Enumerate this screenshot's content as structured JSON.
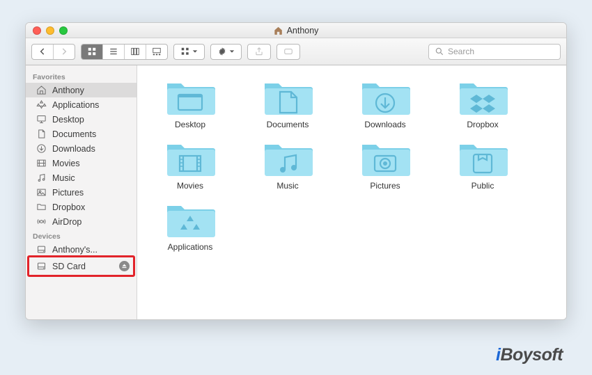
{
  "window": {
    "title": "Anthony"
  },
  "sidebar": {
    "favorites_header": "Favorites",
    "devices_header": "Devices",
    "items": [
      {
        "label": "Anthony",
        "icon": "home"
      },
      {
        "label": "Applications",
        "icon": "apps"
      },
      {
        "label": "Desktop",
        "icon": "desktop"
      },
      {
        "label": "Documents",
        "icon": "doc"
      },
      {
        "label": "Downloads",
        "icon": "down"
      },
      {
        "label": "Movies",
        "icon": "movie"
      },
      {
        "label": "Music",
        "icon": "music"
      },
      {
        "label": "Pictures",
        "icon": "pic"
      },
      {
        "label": "Dropbox",
        "icon": "folder"
      },
      {
        "label": "AirDrop",
        "icon": "airdrop"
      }
    ],
    "devices": [
      {
        "label": "Anthony's..."
      },
      {
        "label": "SD Card"
      }
    ]
  },
  "search": {
    "placeholder": "Search"
  },
  "folders": [
    {
      "label": "Desktop",
      "glyph": "desktop"
    },
    {
      "label": "Documents",
      "glyph": "doc"
    },
    {
      "label": "Downloads",
      "glyph": "down"
    },
    {
      "label": "Dropbox",
      "glyph": "dropbox"
    },
    {
      "label": "Movies",
      "glyph": "movie"
    },
    {
      "label": "Music",
      "glyph": "music"
    },
    {
      "label": "Pictures",
      "glyph": "pic"
    },
    {
      "label": "Public",
      "glyph": "public"
    },
    {
      "label": "Applications",
      "glyph": "apps"
    }
  ],
  "watermark": {
    "prefix": "i",
    "rest": "Boysoft"
  }
}
